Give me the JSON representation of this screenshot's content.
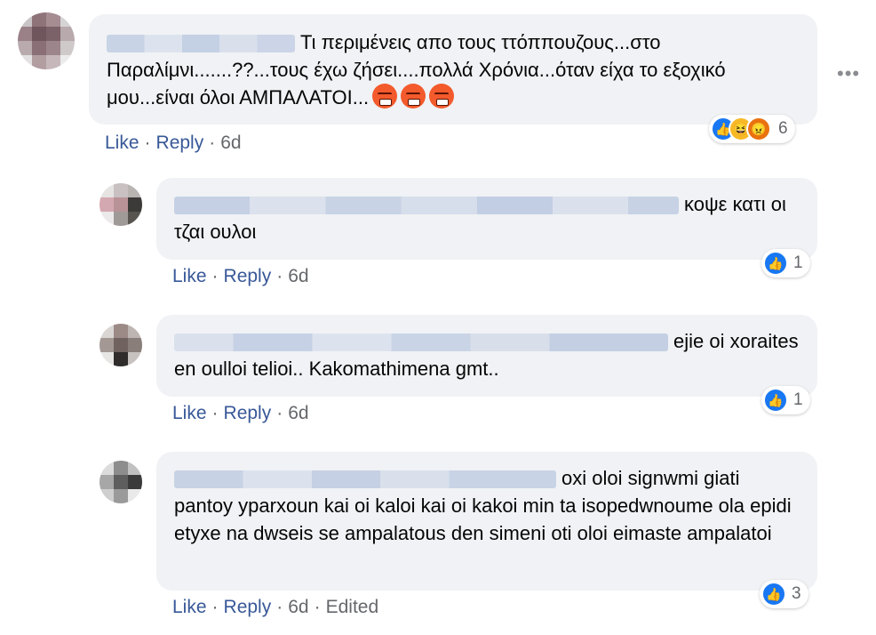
{
  "comments": [
    {
      "text": "Τι περιμένεις απο τους ττόππουζους...στο Παραλίμνι.......??...τους έχω ζήσει....πολλά Χρόνια...όταν είχα το εξοχικό μου...είναι όλοι ΑΜΠΑΛΑΤΟΙ...",
      "inline_emoji": [
        "face-with-symbols-icon",
        "face-with-symbols-icon",
        "face-with-symbols-icon"
      ],
      "reaction_icons": [
        "like-icon",
        "haha-icon",
        "angry-icon"
      ],
      "reaction_count": "6",
      "like": "Like",
      "reply": "Reply",
      "time": "6d"
    },
    {
      "text": "κοψε κατι οι τζαι ουλοι",
      "reaction_icons": [
        "like-icon"
      ],
      "reaction_count": "1",
      "like": "Like",
      "reply": "Reply",
      "time": "6d"
    },
    {
      "text": "ejie oi xoraites en oulloi telioi.. Kakomathimena gmt..",
      "reaction_icons": [
        "like-icon"
      ],
      "reaction_count": "1",
      "like": "Like",
      "reply": "Reply",
      "time": "6d"
    },
    {
      "text": "oxi oloi signwmi giati pantoy yparxoun kai oi kaloi kai oi kakoi min ta isopedwnoume ola epidi etyxe na dwseis se ampalatous den simeni oti oloi eimaste ampalatoi",
      "reaction_icons": [
        "like-icon"
      ],
      "reaction_count": "3",
      "like": "Like",
      "reply": "Reply",
      "time": "6d",
      "edited": "Edited"
    }
  ],
  "colors": {
    "link": "#385898",
    "muted": "#65676b",
    "bubble": "#f0f2f5",
    "like": "#1877f2"
  },
  "more_icon": "more-options-icon"
}
